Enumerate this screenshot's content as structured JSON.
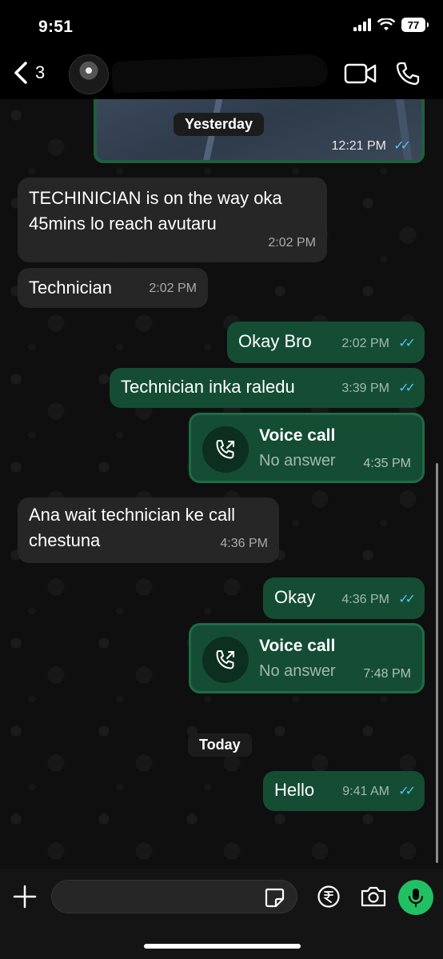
{
  "status_bar": {
    "time": "9:51",
    "battery": "77"
  },
  "header": {
    "back_count": "3"
  },
  "messages": {
    "map_time": "12:21 PM",
    "day_yesterday": "Yesterday",
    "m1_text_line1": "TECHINICIAN is on the way oka",
    "m1_text_line2": "45mins lo reach avutaru",
    "m1_time": "2:02 PM",
    "m2_text": "Technician",
    "m2_time": "2:02 PM",
    "m3_text": "Okay Bro",
    "m3_time": "2:02 PM",
    "m4_text": "Technician inka raledu",
    "m4_time": "3:39 PM",
    "call1_title": "Voice call",
    "call1_sub": "No answer",
    "call1_time": "4:35 PM",
    "m5_text_line1": "Ana wait technician ke call",
    "m5_text_line2": "chestuna",
    "m5_time": "4:36 PM",
    "m6_text": "Okay",
    "m6_time": "4:36 PM",
    "call2_title": "Voice call",
    "call2_sub": "No answer",
    "call2_time": "7:48 PM",
    "day_today": "Today",
    "m7_text": "Hello",
    "m7_time": "9:41 AM"
  },
  "colors": {
    "incoming": "#262626",
    "outgoing": "#144d34",
    "accent": "#21c063",
    "read_ticks": "#4fc3f7"
  },
  "icons": [
    "back-chevron-icon",
    "video-icon",
    "phone-icon",
    "plus-icon",
    "sticker-icon",
    "rupee-icon",
    "camera-icon",
    "mic-icon",
    "missed-call-icon"
  ]
}
